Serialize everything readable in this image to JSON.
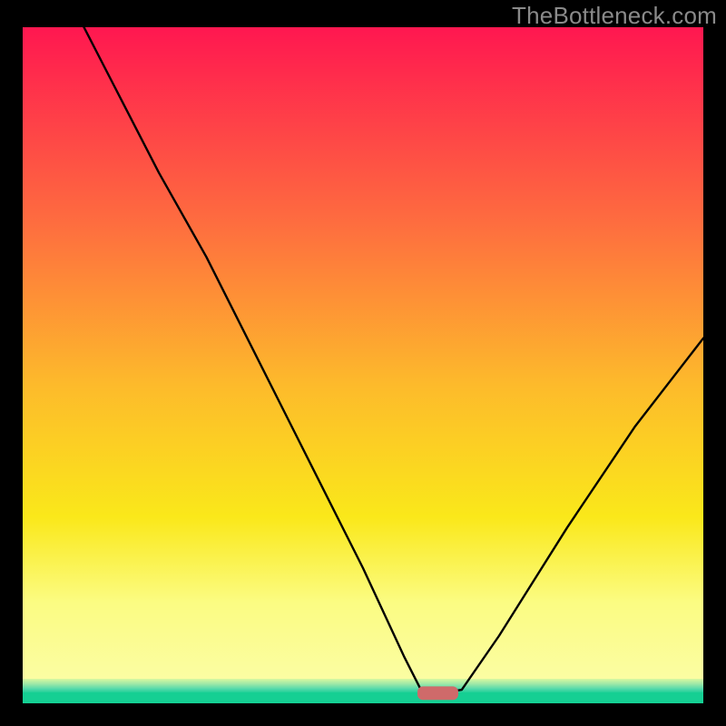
{
  "watermark": "TheBottleneck.com",
  "colors": {
    "grad_top": "#ff1750",
    "grad_mid1": "#fe6d3f",
    "grad_mid2": "#fdbb2b",
    "grad_mid3": "#fae81a",
    "grad_low": "#fbfc82",
    "grad_base": "#fbfda3",
    "green": "#15cf93",
    "marker": "#cf6a6a",
    "line": "#000000",
    "frame": "#000000"
  },
  "chart_data": {
    "type": "line",
    "title": "",
    "xlabel": "",
    "ylabel": "",
    "xlim": [
      0,
      100
    ],
    "ylim": [
      0,
      100
    ],
    "grid": false,
    "legend": false,
    "annotations": [
      "TheBottleneck.com"
    ],
    "marker": {
      "x": 61,
      "y": 1.5,
      "width": 6,
      "height": 2
    },
    "curve": [
      {
        "x": 9,
        "y": 100
      },
      {
        "x": 20,
        "y": 78.5
      },
      {
        "x": 27,
        "y": 66
      },
      {
        "x": 40,
        "y": 40
      },
      {
        "x": 50,
        "y": 20
      },
      {
        "x": 56,
        "y": 7
      },
      {
        "x": 58.5,
        "y": 2
      },
      {
        "x": 61.5,
        "y": 1.5
      },
      {
        "x": 64.5,
        "y": 2
      },
      {
        "x": 70,
        "y": 10
      },
      {
        "x": 80,
        "y": 26
      },
      {
        "x": 90,
        "y": 41
      },
      {
        "x": 100,
        "y": 54
      }
    ]
  }
}
